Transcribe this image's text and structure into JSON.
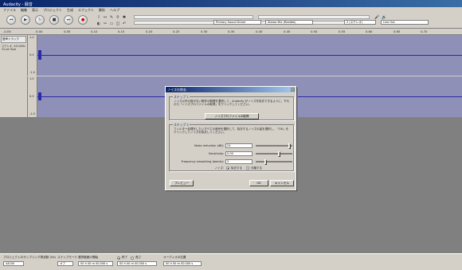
{
  "app": {
    "title": "Audacity - 録音",
    "menu": [
      "ファイル",
      "編集",
      "表示",
      "プロジェクト",
      "生成",
      "エフェクト",
      "解析",
      "ヘルプ"
    ]
  },
  "transport": {
    "buttons": [
      {
        "name": "skip-start",
        "glyph": "⏮"
      },
      {
        "name": "play",
        "glyph": "▶"
      },
      {
        "name": "loop",
        "glyph": "↻"
      },
      {
        "name": "stop",
        "glyph": "■"
      },
      {
        "name": "skip-end",
        "glyph": "⏭"
      },
      {
        "name": "record",
        "glyph": "●"
      }
    ]
  },
  "tools": [
    "I",
    "↔",
    "✎",
    "⚲",
    "✱",
    "◐",
    "✂",
    "▭",
    "◫",
    "↶"
  ],
  "device_bar": {
    "playback_device": "Primary Sound Driver",
    "record_device": "Stereo Mix (Realtek)",
    "record_input": "2 (ステレオ)",
    "playback_output": "Line Out"
  },
  "ruler": {
    "labels": [
      "-0.05",
      "0.00",
      "0.05",
      "0.10",
      "0.15",
      "0.20",
      "0.25",
      "0.30",
      "0.35",
      "0.40",
      "0.45",
      "0.50",
      "0.55",
      "0.60",
      "0.65",
      "0.70"
    ]
  },
  "track": {
    "name": "音声トラック",
    "info": [
      "ステレオ, 44100Hz",
      "32-bit float"
    ],
    "scale_top": [
      "1.0",
      "0.0",
      "-1.0"
    ],
    "scale_bottom": [
      "1.0",
      "0.0",
      "-1.0"
    ]
  },
  "status": {
    "rate_label": "プロジェクトのサンプリング周波数 (Hz)",
    "rate_value": "44100",
    "snap_label": "スナップモード",
    "snap_value": "オフ",
    "selection_start_label": "選択範囲の開始",
    "selection_start_value": "00 h 00 m 00.000 s",
    "end_label": "終了",
    "length_label": "長さ",
    "end_value": "00 h 00 m 00.000 s",
    "audio_pos_label": "オーディオの位置",
    "audio_pos_value": "00 h 00 m 00.000 s"
  },
  "dialog": {
    "title": "ノイズの除去",
    "close": "×",
    "step1_title": "ステップ 1",
    "step1_text": "ノイズ以外の音がない数秒の範囲を選択して、Audacity がノイズを除去できるように、それから「ノイズプロファイルの取得」をクリックしてください。",
    "get_profile_button": "ノイズプロファイルの取得",
    "step2_title": "ステップ 2",
    "step2_text": "フィルター処理をしたいすべての音声を選択して、除去するノイズの量を選択し、「OK」をクリックしてノイズを除去してください。",
    "noise_reduction_label": "Noise reduction (dB):",
    "noise_reduction_value": "24",
    "sensitivity_label": "Sensitivity:",
    "sensitivity_value": "0.00",
    "smoothing_label": "Frequency smoothing (bands):",
    "smoothing_value": "3",
    "noise_label": "ノイズ:",
    "radio_remove": "除去する",
    "radio_isolate": "分離する",
    "preview_button": "プレビュー",
    "ok_button": "OK",
    "cancel_button": "キャンセル",
    "noise_reduction_level": 0.96,
    "sensitivity_level": 0.66,
    "smoothing_level": 0.25
  }
}
